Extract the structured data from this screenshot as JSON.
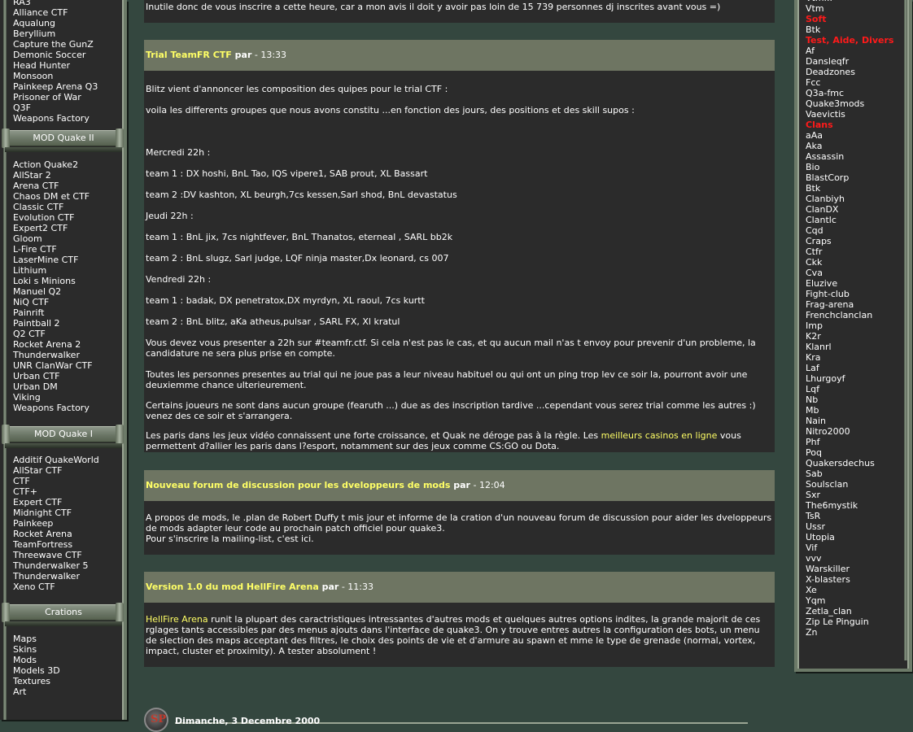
{
  "left_sidebar": {
    "top_items": [
      "RA3",
      "Alliance CTF",
      "Aqualung",
      "Beryllium",
      "Capture the  GunZ",
      "Demonic Soccer",
      "Head Hunter",
      "Monsoon",
      "Painkeep Arena Q3",
      "Prisoner of War",
      "Q3F",
      "Weapons Factory"
    ],
    "quake2_header": "MOD Quake II",
    "quake2_items": [
      "Action Quake2",
      "AllStar 2",
      "Arena CTF",
      "Chaos DM et CTF",
      "Classic CTF",
      "Evolution CTF",
      "Expert2 CTF",
      "Gloom",
      "L-Fire CTF",
      "LaserMine CTF",
      "Lithium",
      "Loki s Minions",
      "Manuel Q2",
      "NiQ CTF",
      "Painrift",
      "Paintball 2",
      "Q2 CTF",
      "Rocket Arena 2",
      "Thunderwalker",
      "UNR ClanWar CTF",
      "Urban CTF",
      "Urban DM",
      "Viking",
      "Weapons Factory"
    ],
    "quake1_header": "MOD Quake I",
    "quake1_items": [
      "Additif QuakeWorld",
      "AllStar CTF",
      "CTF",
      "CTF+",
      "Expert CTF",
      "Midnight CTF",
      "Painkeep",
      "Rocket Arena",
      "TeamFortress",
      "Threewave CTF",
      "Thunderwalker 5",
      "Thunderwalker",
      "Xeno CTF"
    ],
    "creations_header": "Crations",
    "creations_items": [
      "Maps",
      "Skins",
      "Mods",
      "Models 3D",
      "Textures",
      "Art"
    ]
  },
  "right_sidebar": {
    "items": [
      {
        "label": "Vtm... ",
        "cat": false
      },
      {
        "label": "Vtm",
        "cat": false
      },
      {
        "label": "Soft",
        "cat": true
      },
      {
        "label": "Btk",
        "cat": false
      },
      {
        "label": "Test, Aide, Divers",
        "cat": true
      },
      {
        "label": "Af",
        "cat": false
      },
      {
        "label": "Dansleqfr",
        "cat": false
      },
      {
        "label": "Deadzones",
        "cat": false
      },
      {
        "label": "Fcc",
        "cat": false
      },
      {
        "label": "Q3a-fmc",
        "cat": false
      },
      {
        "label": "Quake3mods",
        "cat": false
      },
      {
        "label": "Vaevictis",
        "cat": false
      },
      {
        "label": "Clans",
        "cat": true
      },
      {
        "label": "aAa",
        "cat": false
      },
      {
        "label": "Aka",
        "cat": false
      },
      {
        "label": "Assassin",
        "cat": false
      },
      {
        "label": "Bio",
        "cat": false
      },
      {
        "label": "BlastCorp",
        "cat": false
      },
      {
        "label": "Btk",
        "cat": false
      },
      {
        "label": "Clanbiyh",
        "cat": false
      },
      {
        "label": "ClanDX",
        "cat": false
      },
      {
        "label": "Clantlc",
        "cat": false
      },
      {
        "label": "Cqd",
        "cat": false
      },
      {
        "label": "Craps",
        "cat": false
      },
      {
        "label": "Ctfr",
        "cat": false
      },
      {
        "label": "Ckk",
        "cat": false
      },
      {
        "label": "Cva",
        "cat": false
      },
      {
        "label": "Eluzive",
        "cat": false
      },
      {
        "label": "Fight-club",
        "cat": false
      },
      {
        "label": "Frag-arena",
        "cat": false
      },
      {
        "label": "Frenchclanclan",
        "cat": false
      },
      {
        "label": "Imp",
        "cat": false
      },
      {
        "label": "K2r",
        "cat": false
      },
      {
        "label": "Klanrl",
        "cat": false
      },
      {
        "label": "Kra",
        "cat": false
      },
      {
        "label": "Laf",
        "cat": false
      },
      {
        "label": "Lhurgoyf",
        "cat": false
      },
      {
        "label": "Lqf",
        "cat": false
      },
      {
        "label": "Nb",
        "cat": false
      },
      {
        "label": "Mb",
        "cat": false
      },
      {
        "label": "Nain",
        "cat": false
      },
      {
        "label": "Nitro2000",
        "cat": false
      },
      {
        "label": "Phf",
        "cat": false
      },
      {
        "label": "Poq",
        "cat": false
      },
      {
        "label": "Quakersdechus",
        "cat": false
      },
      {
        "label": "Sab",
        "cat": false
      },
      {
        "label": "Soulsclan",
        "cat": false
      },
      {
        "label": "Sxr",
        "cat": false
      },
      {
        "label": "The6mystik",
        "cat": false
      },
      {
        "label": "TsR",
        "cat": false
      },
      {
        "label": "Ussr",
        "cat": false
      },
      {
        "label": "Utopia",
        "cat": false
      },
      {
        "label": "Vif",
        "cat": false
      },
      {
        "label": "vvv",
        "cat": false
      },
      {
        "label": "Warskiller",
        "cat": false
      },
      {
        "label": "X-blasters",
        "cat": false
      },
      {
        "label": "Xe",
        "cat": false
      },
      {
        "label": "Yqm",
        "cat": false
      },
      {
        "label": "Zetla_clan",
        "cat": false
      },
      {
        "label": "Zip Le Pinguin",
        "cat": false
      },
      {
        "label": "Zn",
        "cat": false
      }
    ]
  },
  "intro": {
    "text": "Inutile donc de vous inscrire a cette heure, car a mon avis il doit y avoir pas loin de 15 739 personnes dj inscrites avant vous =)"
  },
  "news1": {
    "title": "Trial TeamFR CTF",
    "par": "par",
    "time": " - 13:33",
    "paragraphs": [
      "Blitz vient d'annoncer les composition des quipes pour le trial CTF :",
      "voila les differents groupes que nous avons constitu ...en fonction des jours, des positions et des skill supos :",
      "Mercredi 22h :",
      "team 1 : DX hoshi, BnL Tao, IQS vipere1, SAB prout, XL Bassart",
      "team 2 :DV kashton, XL beurgh,7cs kessen,Sarl shod, BnL devastatus",
      "Jeudi 22h :",
      "team 1 : BnL jix, 7cs nightfever, BnL Thanatos, eterneal , SARL bb2k",
      "team 2 : BnL slugz, Sarl judge, LQF ninja master,Dx leonard, cs 007",
      "Vendredi 22h :",
      "team 1 : badak, DX penetratox,DX myrdyn, XL raoul, 7cs kurtt",
      "team 2 : BnL blitz, aKa atheus,pulsar , SARL FX, Xl kratul",
      "Vous devez vous presenter a 22h sur #teamfr.ctf. Si cela n'est pas le cas, et qu aucun mail n'as t envoy pour prevenir d'un probleme, la candidature ne sera plus prise en compte.",
      "Toutes les personnes presentes au trial qui ne joue pas a leur niveau habituel ou qui ont un ping trop lev ce soir la, pourront avoir une deuxiemme chance ulterieurement.",
      "Certains joueurs ne sont dans aucun groupe (fearuth ...) due as des inscription tardive ...cependant vous serez trial comme les autres :) venez des ce soir et s'arrangera."
    ],
    "ad_before": "Les paris dans les jeux vidéo connaissent une forte croissance, et Quak ne déroge pas à la règle. Les ",
    "ad_link": "meilleurs casinos en ligne",
    "ad_after": " vous permettent d?allier les paris dans l?esport, notamment sur des jeux comme CS:GO ou Dota."
  },
  "news2": {
    "title": "Nouveau forum de discussion pour les dveloppeurs de mods",
    "par": "par",
    "time": " - 12:04",
    "p1": "A propos de mods, le .plan de Robert Duffy t mis jour et informe de la cration d'un nouveau forum de discussion pour aider les dveloppeurs de mods adapter leur code au prochain patch officiel pour quake3.",
    "p2": "Pour s'inscrire la mailing-list, c'est ici."
  },
  "news3": {
    "title": "Version 1.0 du mod HellFire Arena",
    "par": "par",
    "time": " - 11:33",
    "link": "HellFire Arena",
    "body": " runit la plupart des caractristiques intressantes d'autres mods et quelques autres options indites, la grande majorit de ces rglages tants accessibles par des menus ajouts dans l'interface de quake3. On y trouve entres autres la configuration des bots, un menu de slection des maps acceptant des filtres, le choix des points de vie et d'armure au spawn et mme le type de grenade (normal, vortex, impact, cluster et proximity). A tester absolument !"
  },
  "date_bar": {
    "icon_letters": "SP",
    "date": "Dimanche, 3 Decembre 2000"
  },
  "colors": {
    "background": "#34473f",
    "panel": "#2b2b2b",
    "title_bar": "#6e7562",
    "link": "#ffff66",
    "category": "#ff1a1a"
  }
}
